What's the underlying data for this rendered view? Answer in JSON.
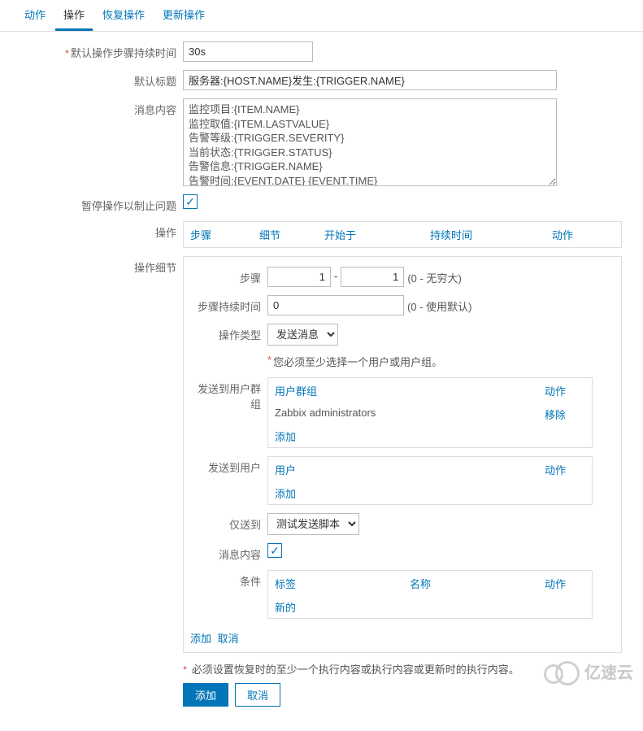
{
  "tabs": {
    "action": "动作",
    "operation": "操作",
    "recovery": "恢复操作",
    "update": "更新操作"
  },
  "form": {
    "step_duration_label": "默认操作步骤持续时间",
    "step_duration_value": "30s",
    "default_title_label": "默认标题",
    "default_title_value": "服务器:{HOST.NAME}发生:{TRIGGER.NAME}",
    "message_content_label": "消息内容",
    "message_content_value": "监控项目:{ITEM.NAME}\n监控取值:{ITEM.LASTVALUE}\n告警等级:{TRIGGER.SEVERITY}\n当前状态:{TRIGGER.STATUS}\n告警信息:{TRIGGER.NAME}\n告警时间:{EVENT.DATE} {EVENT.TIME}\n事件ID:{EVENT.ID}",
    "pause_label": "暂停操作以制止问题",
    "ops_label": "操作",
    "ops_headers": {
      "step": "步骤",
      "detail": "细节",
      "start": "开始于",
      "duration": "持续时间",
      "action": "动作"
    },
    "detail_label": "操作细节",
    "detail": {
      "step_label": "步骤",
      "step_from": "1",
      "step_to": "1",
      "step_hint": "(0 - 无穷大)",
      "step_dur_label": "步骤持续时间",
      "step_dur_value": "0",
      "step_dur_hint": "(0 - 使用默认)",
      "op_type_label": "操作类型",
      "op_type_value": "发送消息",
      "required_note": "您必须至少选择一个用户或用户组。",
      "send_group_label": "发送到用户群组",
      "group_header": {
        "group": "用户群组",
        "action": "动作"
      },
      "group_row": {
        "name": "Zabbix administrators",
        "action": "移除"
      },
      "add": "添加",
      "send_user_label": "发送到用户",
      "user_header": {
        "user": "用户",
        "action": "动作"
      },
      "only_send_label": "仅送到",
      "only_send_value": "测试发送脚本",
      "msg_content_label": "消息内容",
      "condition_label": "条件",
      "cond_header": {
        "label": "标签",
        "name": "名称",
        "action": "动作"
      },
      "new": "新的",
      "cancel": "取消"
    },
    "required_recovery": "必须设置恢复时的至少一个执行内容或执行内容或更新时的执行内容。",
    "btn_add": "添加",
    "btn_cancel": "取消"
  },
  "watermark": "亿速云"
}
